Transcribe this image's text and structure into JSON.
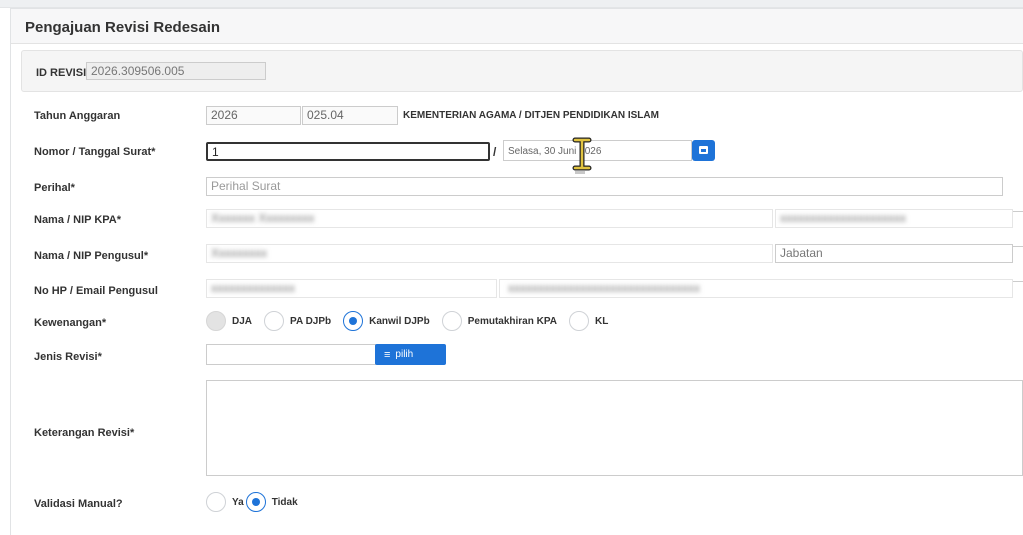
{
  "panel": {
    "title": "Pengajuan Revisi Redesain"
  },
  "id_revisi": {
    "label": "ID REVISI",
    "value": "2026.309506.005"
  },
  "tahun_anggaran": {
    "label": "Tahun Anggaran",
    "tahun": "2026",
    "kode": "025.04",
    "ministry": "KEMENTERIAN AGAMA / DITJEN PENDIDIKAN ISLAM"
  },
  "nomor_surat": {
    "label": "Nomor / Tanggal Surat*",
    "nomor_value": "1",
    "separator": "/",
    "tanggal_value": "Selasa, 30 Juni 2026"
  },
  "perihal": {
    "label": "Perihal*",
    "placeholder": "Perihal Surat"
  },
  "nama_kpa": {
    "label": "Nama / NIP KPA*",
    "nama_blurred": "Xxxxxxx Xxxxxxxxx",
    "nip_blurred": "xxxxxxxxxxxxxxxxxxxxx"
  },
  "nama_pengusul": {
    "label": "Nama / NIP Pengusul*",
    "nama_blurred": "Xxxxxxxxx",
    "jabatan_placeholder": "Jabatan"
  },
  "hp_email": {
    "label": "No HP / Email Pengusul",
    "hp_blurred": "xxxxxxxxxxxxxx",
    "email_blurred": "xxxxxxxxxxxxxxxxxxxxxxxxxxxxxxxx"
  },
  "kewenangan": {
    "label": "Kewenangan*",
    "options": [
      {
        "label": "DJA",
        "state": "disabled"
      },
      {
        "label": "PA DJPb",
        "state": "unchecked"
      },
      {
        "label": "Kanwil DJPb",
        "state": "checked"
      },
      {
        "label": "Pemutakhiran KPA",
        "state": "unchecked"
      },
      {
        "label": "KL",
        "state": "unchecked"
      }
    ]
  },
  "jenis_revisi": {
    "label": "Jenis Revisi*",
    "button_label": "pilih",
    "button_icon": "list-icon"
  },
  "keterangan_revisi": {
    "label": "Keterangan Revisi*"
  },
  "validasi_manual": {
    "label": "Validasi Manual?",
    "options": [
      {
        "label": "Ya",
        "state": "unchecked"
      },
      {
        "label": "Tidak",
        "state": "checked"
      }
    ]
  },
  "colors": {
    "accent": "#1e73d8",
    "header_bg": "#f7f7f8",
    "border": "#cccccc"
  }
}
